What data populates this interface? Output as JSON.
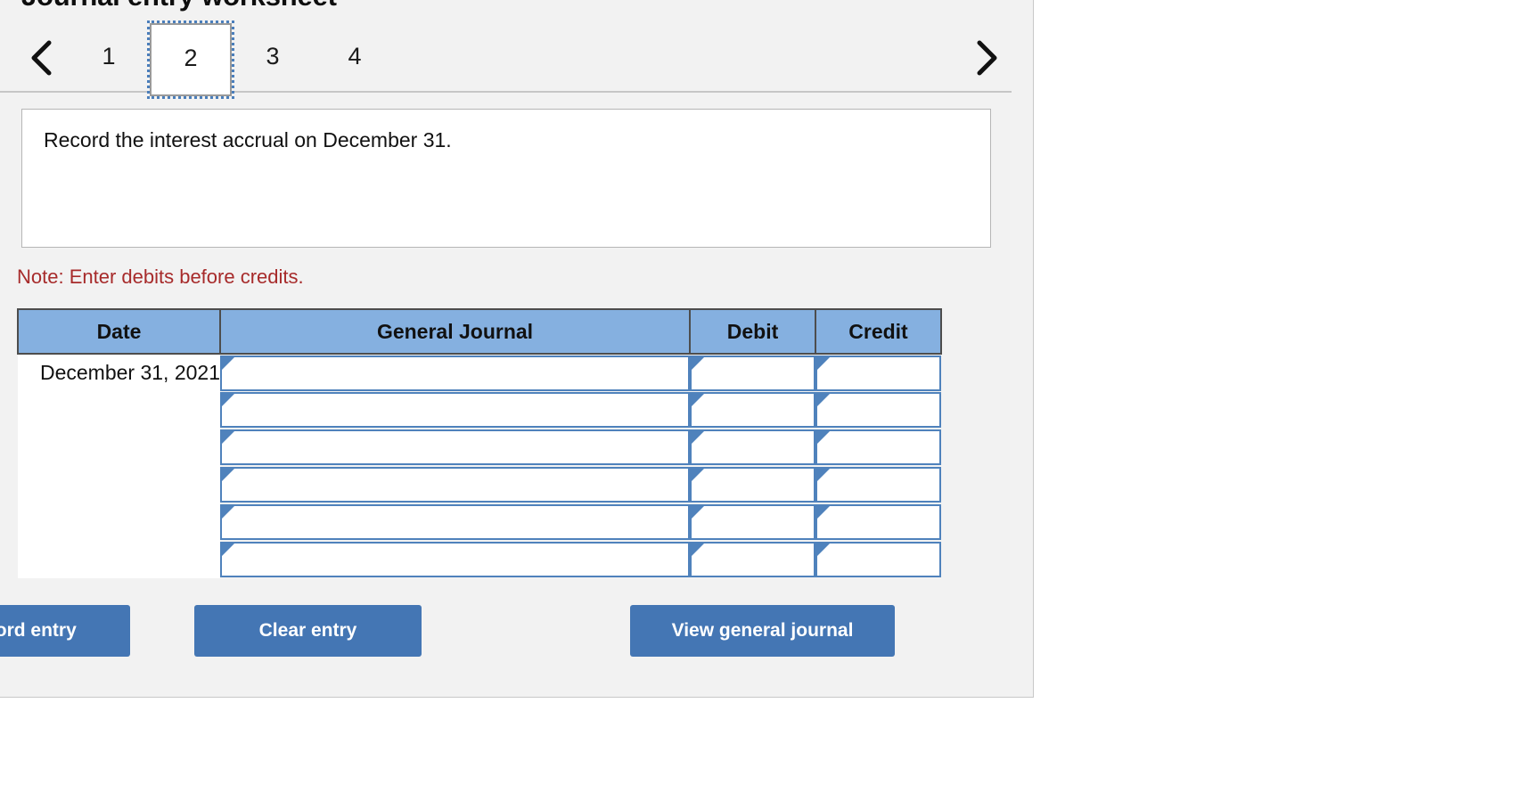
{
  "panel": {
    "title": "Journal entry worksheet"
  },
  "pager": {
    "prev_icon": "chevron-left-icon",
    "next_icon": "chevron-right-icon",
    "pages": [
      {
        "label": "1",
        "active": false
      },
      {
        "label": "2",
        "active": true
      },
      {
        "label": "3",
        "active": false
      },
      {
        "label": "4",
        "active": false
      }
    ],
    "active_page": "2"
  },
  "description": {
    "text": "Record the interest accrual on December 31."
  },
  "note": {
    "text": "Note: Enter debits before credits.",
    "color": "#a72b2b"
  },
  "journal_table": {
    "headers": {
      "date": "Date",
      "general_journal": "General Journal",
      "debit": "Debit",
      "credit": "Credit"
    },
    "header_bg": "#85b0e0",
    "rows": [
      {
        "date": "December 31, 2021",
        "general_journal": "",
        "debit": "",
        "credit": ""
      },
      {
        "date": "",
        "general_journal": "",
        "debit": "",
        "credit": ""
      },
      {
        "date": "",
        "general_journal": "",
        "debit": "",
        "credit": ""
      },
      {
        "date": "",
        "general_journal": "",
        "debit": "",
        "credit": ""
      },
      {
        "date": "",
        "general_journal": "",
        "debit": "",
        "credit": ""
      },
      {
        "date": "",
        "general_journal": "",
        "debit": "",
        "credit": ""
      }
    ]
  },
  "actions": {
    "record_label": "Record entry",
    "clear_label": "Clear entry",
    "view_label": "View general journal",
    "button_color": "#4476b4"
  }
}
